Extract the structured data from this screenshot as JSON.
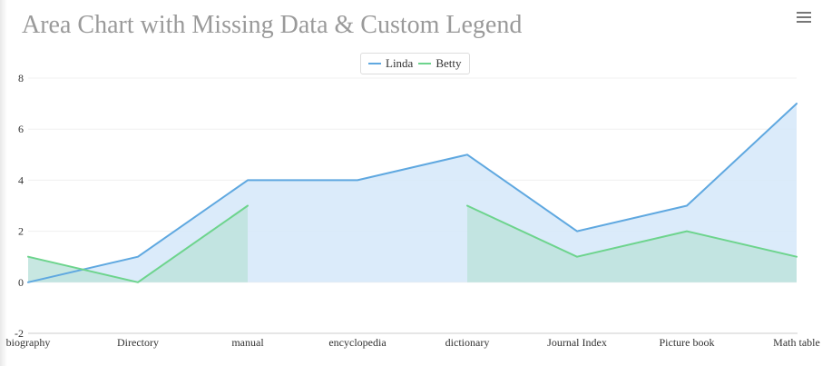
{
  "title": "Area Chart with Missing Data & Custom Legend",
  "menu_icon": "hamburger-menu-icon",
  "colors": {
    "title": "#9a9a9a",
    "grid": "#f0f0f0",
    "axis": "#cccccc",
    "text": "#333333"
  },
  "chart_data": {
    "type": "area",
    "title": "Area Chart with Missing Data & Custom Legend",
    "categories": [
      "biography",
      "Directory",
      "manual",
      "encyclopedia",
      "dictionary",
      "Journal Index",
      "Picture book",
      "Math table"
    ],
    "ylim": [
      -2,
      8
    ],
    "yticks": [
      -2,
      0,
      2,
      4,
      6,
      8
    ],
    "grid": true,
    "legend_position": "top-center",
    "series": [
      {
        "name": "Linda",
        "values": [
          0,
          1,
          4,
          4,
          5,
          2,
          3,
          7
        ],
        "line_color": "#5fa8e0",
        "fill_color": "#d5e8f9"
      },
      {
        "name": "Betty",
        "values": [
          1,
          0,
          3,
          null,
          3,
          1,
          2,
          1
        ],
        "line_color": "#6dd48d",
        "fill_color": "#bde3dc"
      }
    ]
  }
}
